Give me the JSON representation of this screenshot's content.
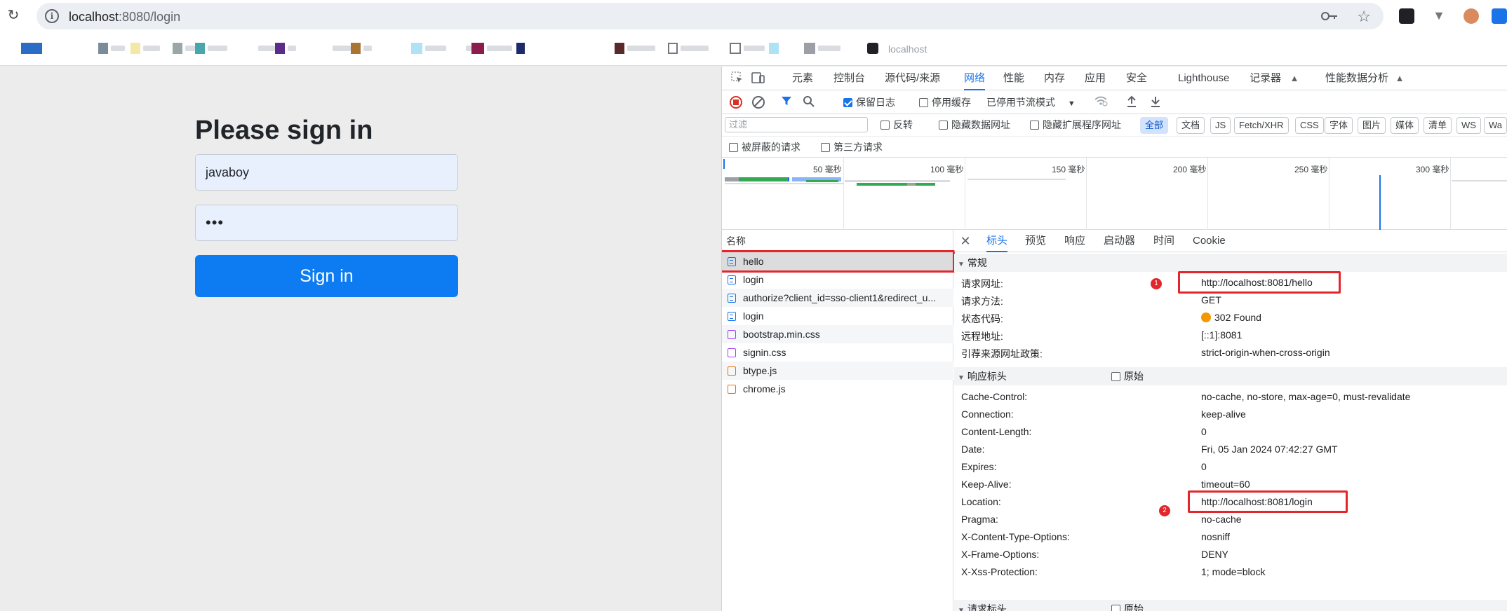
{
  "browser": {
    "url_host": "localhost",
    "url_path": ":8080/login",
    "bookmark_last": "localhost"
  },
  "login": {
    "title": "Please sign in",
    "username_value": "javaboy",
    "password_value": "•••",
    "submit_label": "Sign in"
  },
  "devtools": {
    "tabs": [
      "元素",
      "控制台",
      "源代码/来源",
      "网络",
      "性能",
      "内存",
      "应用",
      "安全",
      "Lighthouse",
      "记录器",
      "性能数据分析"
    ],
    "active_tab": "网络",
    "toolbar": {
      "preserve_log": "保留日志",
      "disable_cache": "停用缓存",
      "throttling": "已停用节流模式"
    },
    "filter": {
      "placeholder": "过滤",
      "invert": "反转",
      "hide_data_urls": "隐藏数据网址",
      "hide_ext_urls": "隐藏扩展程序网址",
      "chips": [
        "全部",
        "文档",
        "JS",
        "Fetch/XHR",
        "CSS",
        "字体",
        "图片",
        "媒体",
        "清单",
        "WS",
        "Wa"
      ],
      "blocked": "被屏蔽的请求",
      "third_party": "第三方请求"
    },
    "overview_ticks": [
      "50 毫秒",
      "100 毫秒",
      "150 毫秒",
      "200 毫秒",
      "250 毫秒",
      "300 毫秒"
    ],
    "names_header": "名称",
    "requests": [
      {
        "name": "hello",
        "type": "doc"
      },
      {
        "name": "login",
        "type": "doc"
      },
      {
        "name": "authorize?client_id=sso-client1&redirect_u...",
        "type": "doc"
      },
      {
        "name": "login",
        "type": "doc"
      },
      {
        "name": "bootstrap.min.css",
        "type": "css"
      },
      {
        "name": "signin.css",
        "type": "css"
      },
      {
        "name": "btype.js",
        "type": "js"
      },
      {
        "name": "chrome.js",
        "type": "js"
      }
    ],
    "detail_tabs": [
      "标头",
      "预览",
      "响应",
      "启动器",
      "时间",
      "Cookie"
    ],
    "general": {
      "title": "常规",
      "rows": [
        {
          "k": "请求网址:",
          "v": "http://localhost:8081/hello"
        },
        {
          "k": "请求方法:",
          "v": "GET"
        },
        {
          "k": "状态代码:",
          "v": "302 Found"
        },
        {
          "k": "远程地址:",
          "v": "[::1]:8081"
        },
        {
          "k": "引荐来源网址政策:",
          "v": "strict-origin-when-cross-origin"
        }
      ]
    },
    "response_headers": {
      "title": "响应标头",
      "raw_label": "原始",
      "rows": [
        {
          "k": "Cache-Control:",
          "v": "no-cache, no-store, max-age=0, must-revalidate"
        },
        {
          "k": "Connection:",
          "v": "keep-alive"
        },
        {
          "k": "Content-Length:",
          "v": "0"
        },
        {
          "k": "Date:",
          "v": "Fri, 05 Jan 2024 07:42:27 GMT"
        },
        {
          "k": "Expires:",
          "v": "0"
        },
        {
          "k": "Keep-Alive:",
          "v": "timeout=60"
        },
        {
          "k": "Location:",
          "v": "http://localhost:8081/login"
        },
        {
          "k": "Pragma:",
          "v": "no-cache"
        },
        {
          "k": "X-Content-Type-Options:",
          "v": "nosniff"
        },
        {
          "k": "X-Frame-Options:",
          "v": "DENY"
        },
        {
          "k": "X-Xss-Protection:",
          "v": "1; mode=block"
        }
      ]
    },
    "request_headers": {
      "title": "请求标头",
      "raw_label": "原始"
    },
    "markers": [
      "1",
      "2"
    ]
  },
  "colors": {
    "accent": "#1a73e8",
    "annotation": "#e3262b",
    "button": "#0d7cf2",
    "status_302": "#f29900"
  }
}
